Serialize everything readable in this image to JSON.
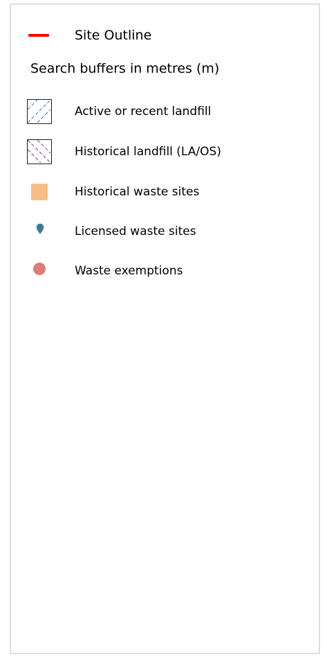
{
  "legend": {
    "site_outline": {
      "label": "Site Outline",
      "color": "#ff0000",
      "icon": "red-line-icon"
    },
    "search_buffers": {
      "label": "Search buffers in metres (m)"
    },
    "items": [
      {
        "label": "Active or recent landfill",
        "icon": "blue-hatch-icon",
        "color": "#2a6fd0"
      },
      {
        "label": "Historical landfill (LA/OS)",
        "icon": "purple-hatch-icon",
        "color": "#8a2a86"
      },
      {
        "label": "Historical waste sites",
        "icon": "orange-square-icon",
        "color": "#f9bd84"
      },
      {
        "label": "Licensed waste sites",
        "icon": "teal-pin-icon",
        "color": "#3b7a94"
      },
      {
        "label": "Waste exemptions",
        "icon": "red-dot-icon",
        "color": "#e07b78"
      }
    ]
  }
}
